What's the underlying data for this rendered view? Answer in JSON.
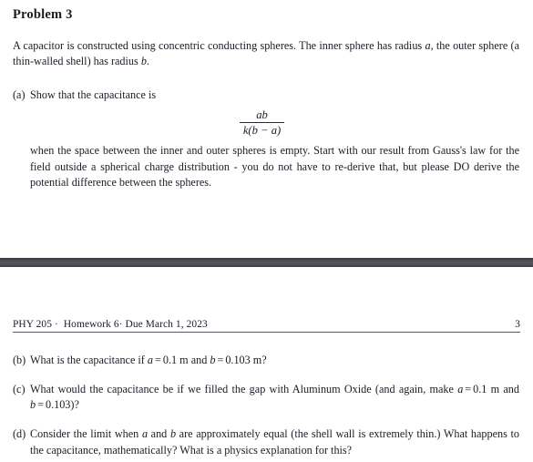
{
  "document": {
    "problem_heading": "Problem 3",
    "intro_paragraph": "A capacitor is constructed using concentric conducting spheres. The inner sphere has radius a, the outer sphere (a thin-walled shell) has radius b.",
    "items": [
      {
        "label": "(a)",
        "text": "Show that the capacitance is",
        "formula": {
          "numerator": "ab",
          "denominator": "k(b − a)"
        },
        "continuation": "when the space between the inner and outer spheres is empty. Start with our result from Gauss's law for the field outside a spherical charge distribution - you do not have to re-derive that, but please DO derive the potential difference between the spheres."
      },
      {
        "label": "(b)",
        "text": "What is the capacitance if a = 0.1 m and b = 0.103 m?"
      },
      {
        "label": "(c)",
        "text": "What would the capacitance be if we filled the gap with Aluminum Oxide (and again, make a = 0.1 m and b = 0.103)?"
      },
      {
        "label": "(d)",
        "text": "Consider the limit when a and b are approximately equal (the shell wall is extremely thin.) What happens to the capacitance, mathematically? What is a physics explanation for this?"
      }
    ]
  },
  "footer": {
    "course": "PHY 205",
    "separator": "·",
    "assignment": "Homework 6",
    "due": "Due March 1, 2023",
    "page_number": "3"
  },
  "style": {
    "text_color": "#1b1b26",
    "page_background": "#ffffff",
    "page_break_color": "#4c5055",
    "rule_color": "#55555f"
  }
}
